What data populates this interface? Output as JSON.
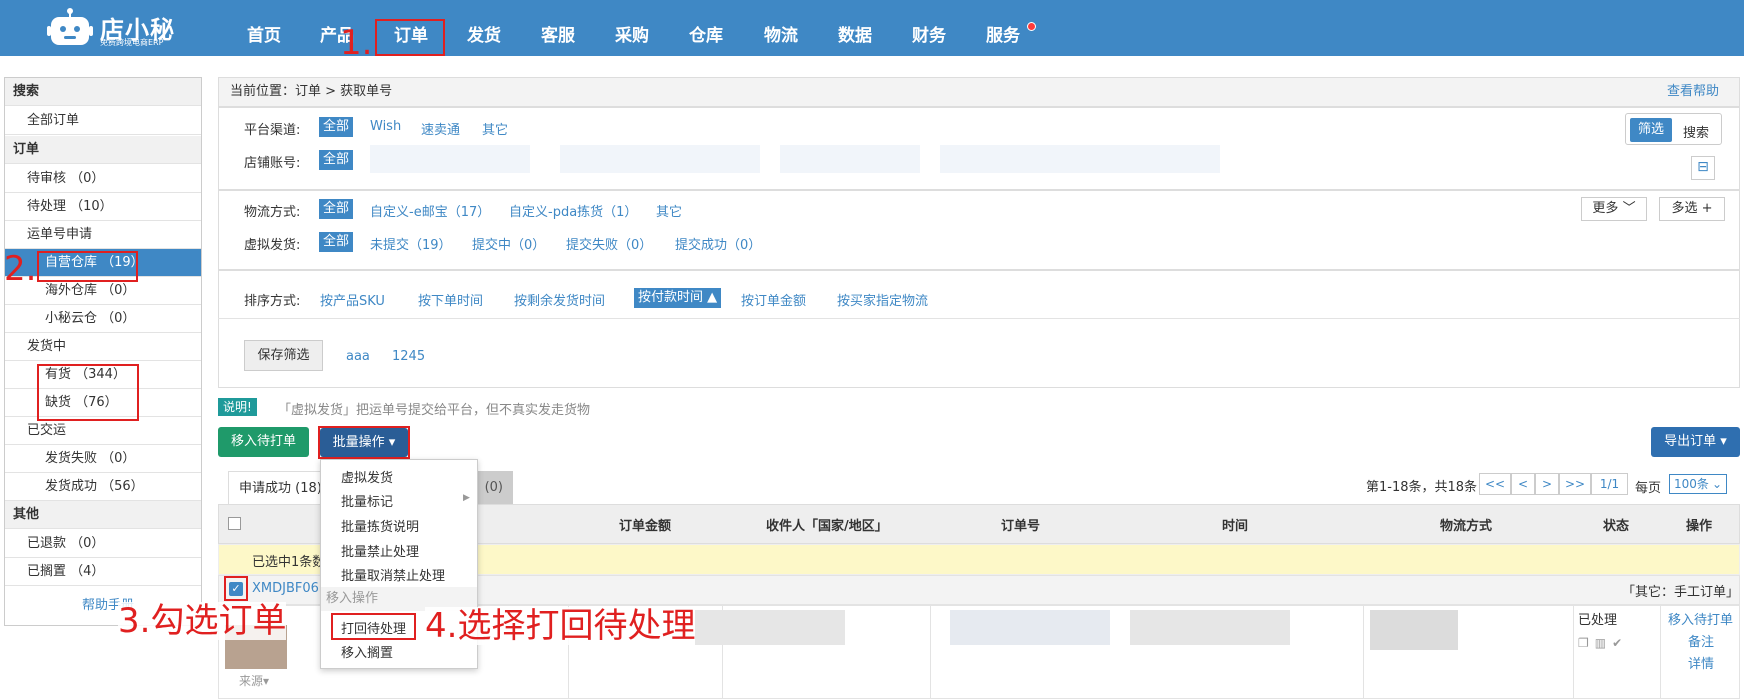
{
  "app": {
    "logo_text": "店小秘",
    "logo_sub": "免费跨境电商ERP"
  },
  "nav": [
    "首页",
    "产品",
    "订单",
    "发货",
    "客服",
    "采购",
    "仓库",
    "物流",
    "数据",
    "财务",
    "服务"
  ],
  "annotations": {
    "step1": "1.",
    "step2": "2.",
    "step3": "3.勾选订单",
    "step4": "4.选择打回待处理"
  },
  "sidebar": {
    "search_head": "搜索",
    "all_orders": "全部订单",
    "order_head": "订单",
    "items": [
      {
        "label": "待审核 （0）"
      },
      {
        "label": "待处理 （10）"
      },
      {
        "label": "运单号申请"
      },
      {
        "label": "自营仓库 （19）"
      },
      {
        "label": "海外仓库 （0）"
      },
      {
        "label": "小秘云仓 （0）"
      },
      {
        "label": "发货中"
      },
      {
        "label": "有货 （344）"
      },
      {
        "label": "缺货 （76）"
      },
      {
        "label": "已交运"
      },
      {
        "label": "发货失败 （0）"
      },
      {
        "label": "发货成功 （56）"
      }
    ],
    "other_head": "其他",
    "refunded": "已退款 （0）",
    "shelved": "已搁置 （4）",
    "help": "帮助手册"
  },
  "breadcrumb": {
    "prefix": "当前位置：",
    "path": "订单 > 获取单号",
    "help": "查看帮助"
  },
  "filters": {
    "platform_label": "平台渠道:",
    "platform_all": "全部",
    "platform_opts": [
      "Wish",
      "速卖通",
      "其它"
    ],
    "store_label": "店铺账号:",
    "store_all": "全部",
    "toggle": {
      "filter": "筛选",
      "search": "搜索"
    },
    "logistics_label": "物流方式:",
    "logistics_all": "全部",
    "logistics_opts": [
      "自定义-e邮宝（17）",
      "自定义-pda拣货（1）",
      "其它"
    ],
    "virtual_label": "虚拟发货:",
    "virtual_all": "全部",
    "virtual_opts": [
      "未提交（19）",
      "提交中（0）",
      "提交失败（0）",
      "提交成功（0）"
    ],
    "more": "更多",
    "multi": "多选 +",
    "sort_label": "排序方式:",
    "sort_opts": [
      "按产品SKU",
      "按下单时间",
      "按剩余发货时间",
      "按付款时间",
      "按订单金额",
      "按买家指定物流"
    ],
    "sort_active": "按付款时间 ▲",
    "save_filter": "保存筛选",
    "saved": [
      "aaa",
      "1245"
    ]
  },
  "notice": {
    "badge": "说明!",
    "text": "「虚拟发货」把运单号提交给平台，但不真实发走货物"
  },
  "toolbar": {
    "move_print": "移入待打单",
    "batch": "批量操作 ▾",
    "export": "导出订单 ▾"
  },
  "tabs": {
    "success": "申请成功 (18)",
    "fail": "(0)"
  },
  "pagination": {
    "summary": "第1-18条，共18条",
    "first": "<<",
    "prev": "<",
    "next": ">",
    "last": ">>",
    "page": "1/1",
    "per_page_label": "每页",
    "per_page": "100条"
  },
  "table": {
    "headers": [
      "订单金额",
      "收件人「国家/地区」",
      "订单号",
      "时间",
      "物流方式",
      "状态",
      "操作"
    ],
    "selected_note": "已选中1条数",
    "order_no": "XMDJBF06",
    "order_tag": "「其它：手工订单」",
    "status": "已处理",
    "actions": [
      "移入待打单",
      "备注",
      "详情"
    ],
    "source": "来源"
  },
  "dropdown": {
    "items": [
      "虚拟发货",
      "批量标记",
      "批量拣货说明",
      "批量禁止处理",
      "批量取消禁止处理"
    ],
    "section": "移入操作",
    "move_items": [
      "打回待处理",
      "移入搁置"
    ]
  }
}
